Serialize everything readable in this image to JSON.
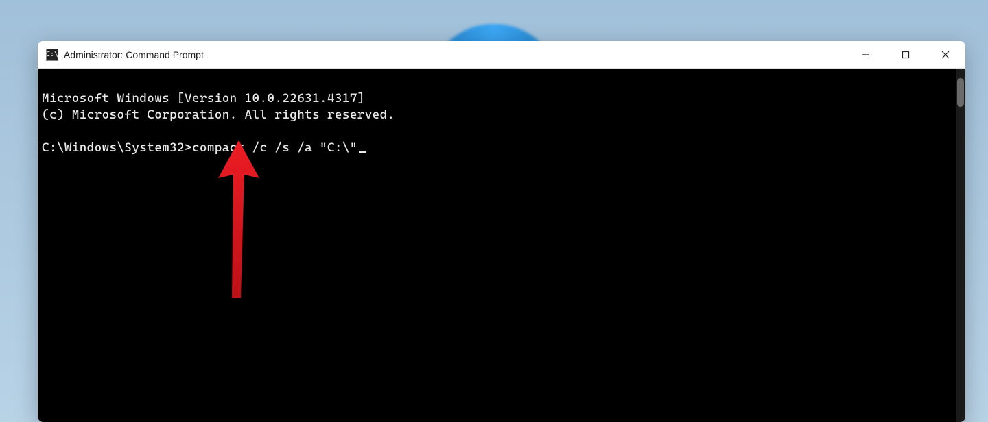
{
  "window": {
    "title": "Administrator: Command Prompt",
    "icon_label": "C:\\"
  },
  "terminal": {
    "line1": "Microsoft Windows [Version 10.0.22631.4317]",
    "line2": "(c) Microsoft Corporation. All rights reserved.",
    "prompt": "C:\\Windows\\System32>",
    "command": "compact /c /s /a \"C:\\\""
  },
  "annotation": {
    "color": "#ed1c24"
  }
}
